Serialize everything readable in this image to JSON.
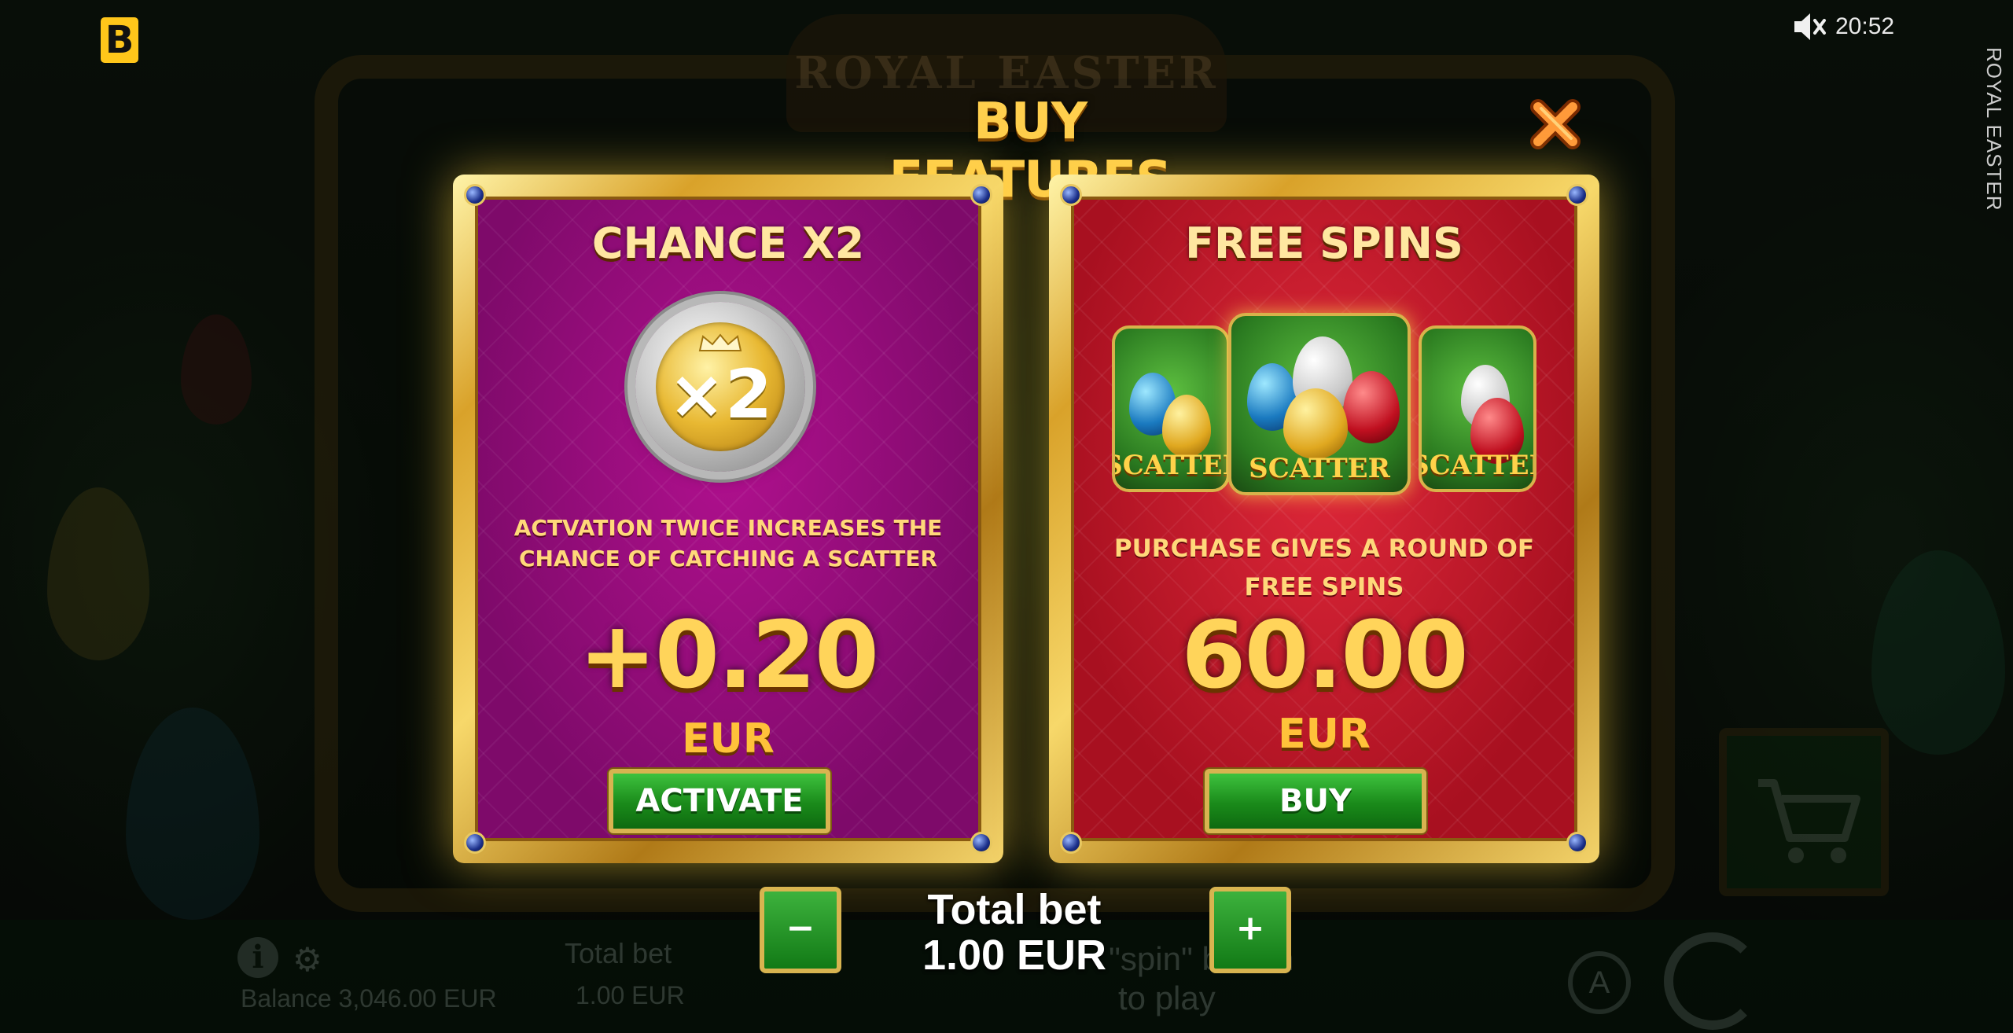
{
  "app": {
    "logo_letter": "B",
    "clock": "20:52",
    "game_name_vertical": "ROYAL EASTER",
    "bg_title": "ROYAL EASTER"
  },
  "popup": {
    "title": "BUY FEATURES",
    "close_icon": "close-x-icon"
  },
  "features": [
    {
      "title": "CHANCE X2",
      "coin_text": "×2",
      "description": "ACTVATION TWICE INCREASES THE CHANCE OF CATCHING A SCATTER",
      "price": "+0.20",
      "currency": "EUR",
      "button": "ACTIVATE"
    },
    {
      "title": "FREE SPINS",
      "scatter_label": "SCATTER",
      "description": "PURCHASE GIVES A ROUND OF FREE SPINS",
      "price": "60.00",
      "currency": "EUR",
      "button": "BUY"
    }
  ],
  "bet": {
    "minus": "−",
    "plus": "+",
    "label": "Total bet",
    "value": "1.00 EUR"
  },
  "background_bar": {
    "balance": "Balance 3,046.00 EUR",
    "total_bet_label": "Total bet",
    "total_bet_value": "1.00 EUR",
    "spin_hint_1": "\"spin\" button",
    "spin_hint_2": "to play",
    "auto_label": "A"
  },
  "colors": {
    "gold": "#ffcf4d",
    "purple_card": "#9a0c7e",
    "red_card": "#c81a2c",
    "green_button": "#1a8a1a"
  }
}
